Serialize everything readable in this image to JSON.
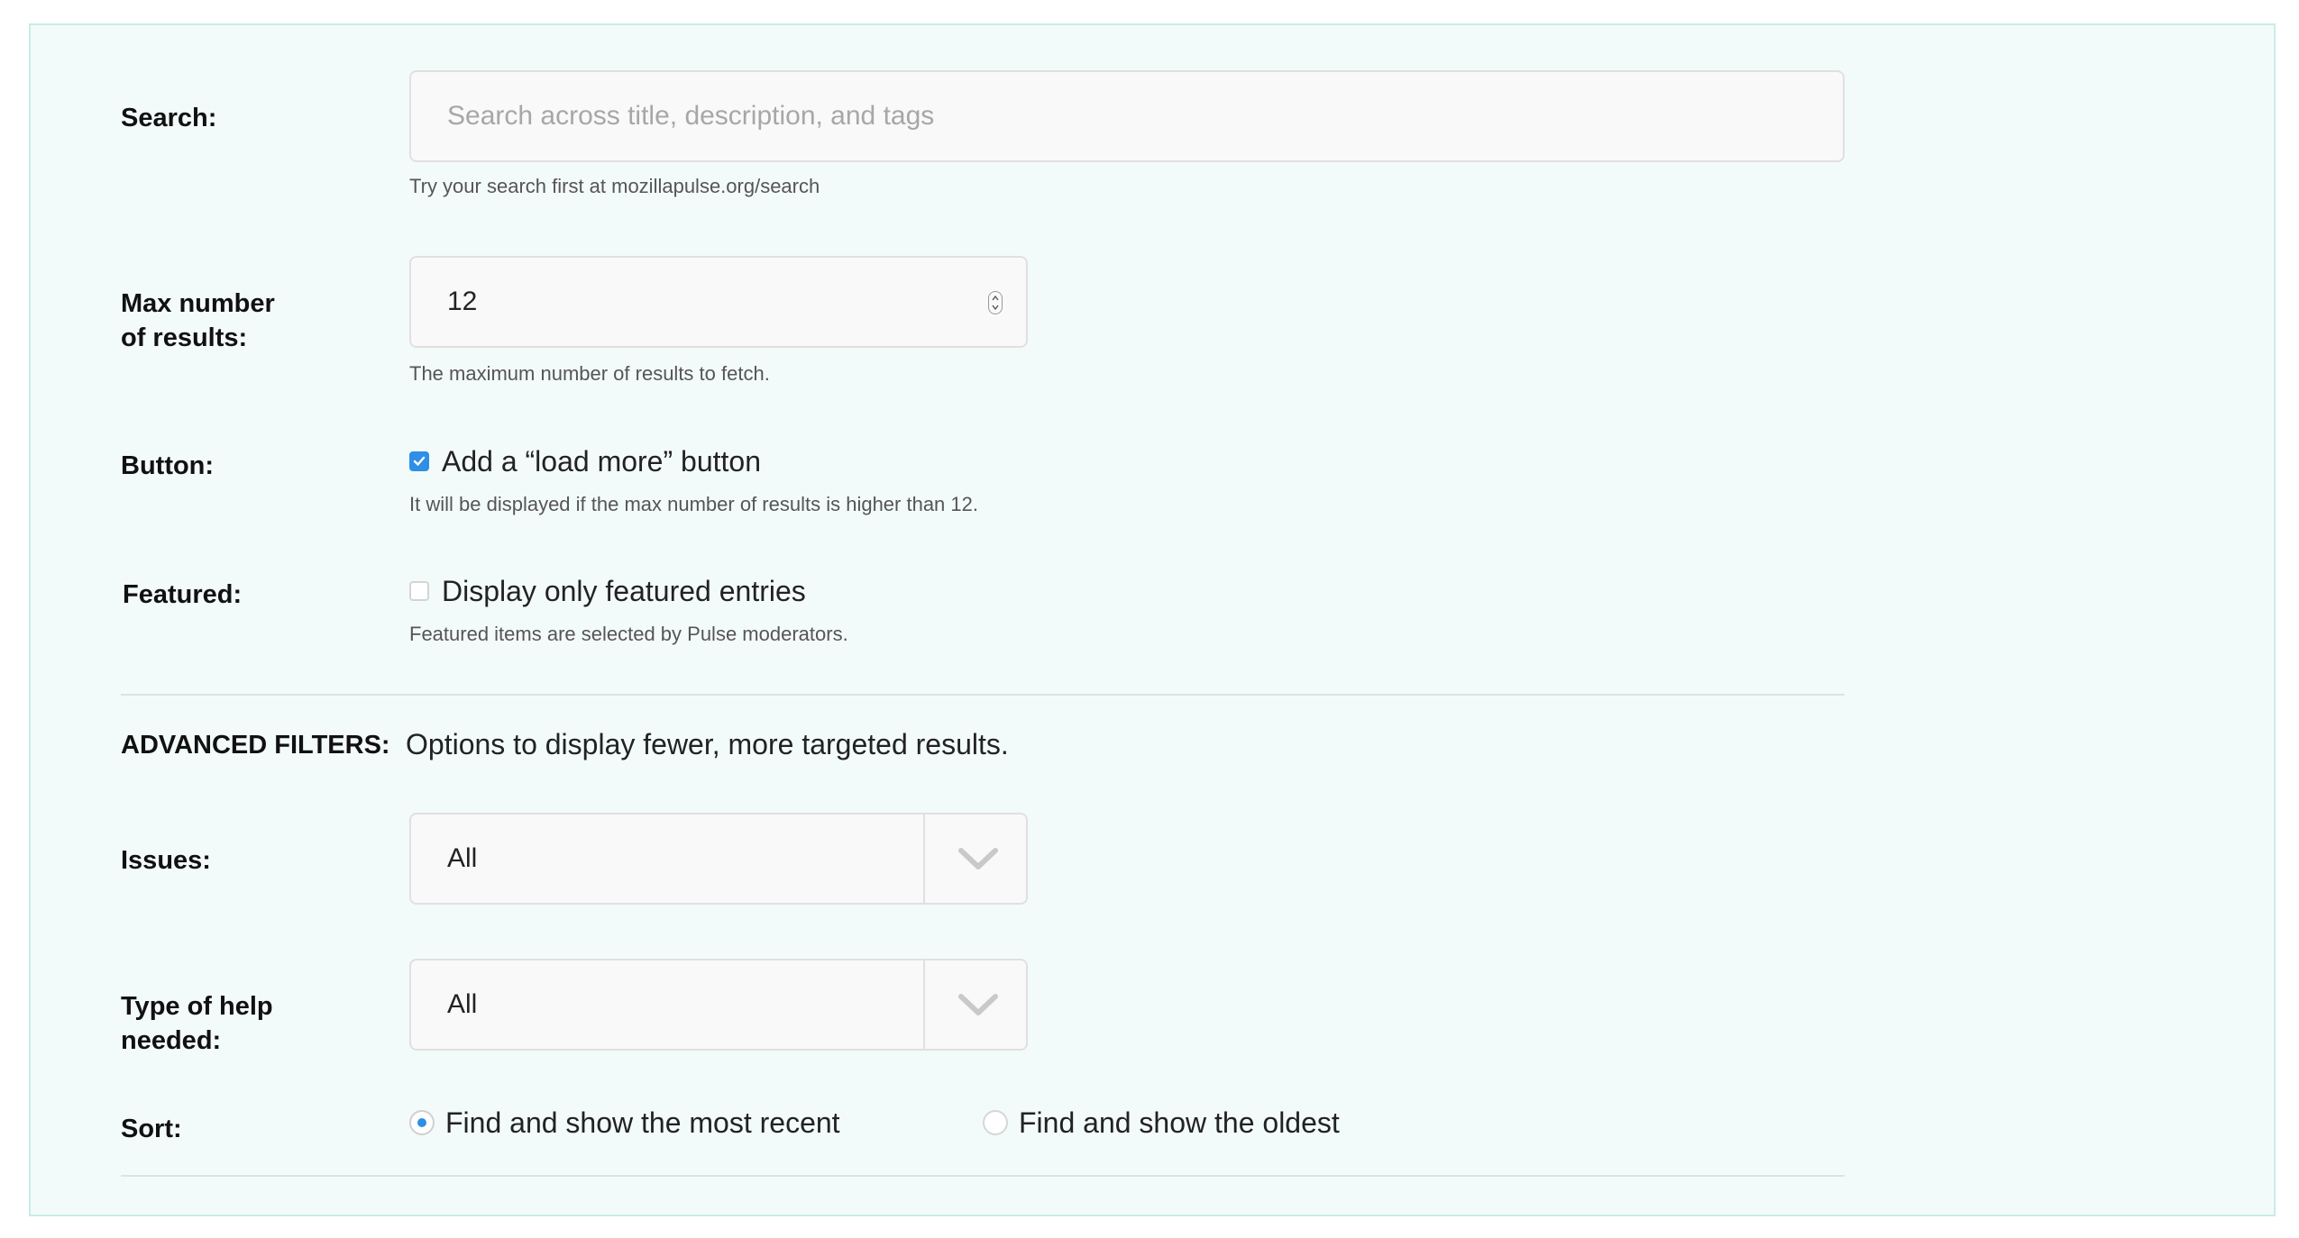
{
  "search": {
    "label": "Search:",
    "placeholder": "Search across title, description, and tags",
    "help": "Try your search first at mozillapulse.org/search"
  },
  "max_results": {
    "label_line1": "Max number",
    "label_line2": "of results:",
    "value": "12",
    "help": "The maximum number of results to fetch."
  },
  "button": {
    "label": "Button:",
    "checkbox_label": "Add a “load more” button",
    "checked": true,
    "help": "It will be displayed if the max number of results is higher than 12."
  },
  "featured": {
    "label": "Featured:",
    "checkbox_label": "Display only featured entries",
    "checked": false,
    "help": "Featured items are selected by Pulse moderators."
  },
  "advanced": {
    "label": "ADVANCED FILTERS:",
    "description": "Options to display fewer, more targeted results."
  },
  "issues": {
    "label": "Issues:",
    "selected": "All"
  },
  "help_type": {
    "label_line1": "Type of help",
    "label_line2": "needed:",
    "selected": "All"
  },
  "sort": {
    "label": "Sort:",
    "options": [
      {
        "label": "Find and show the most recent",
        "selected": true
      },
      {
        "label": "Find and show the oldest",
        "selected": false
      }
    ]
  },
  "colors": {
    "panel_bg": "#f3fbfa",
    "panel_border": "#c8ece8",
    "accent": "#2f8fe6",
    "field_bg": "#f9f9f9",
    "field_border": "#e0e0e0"
  }
}
